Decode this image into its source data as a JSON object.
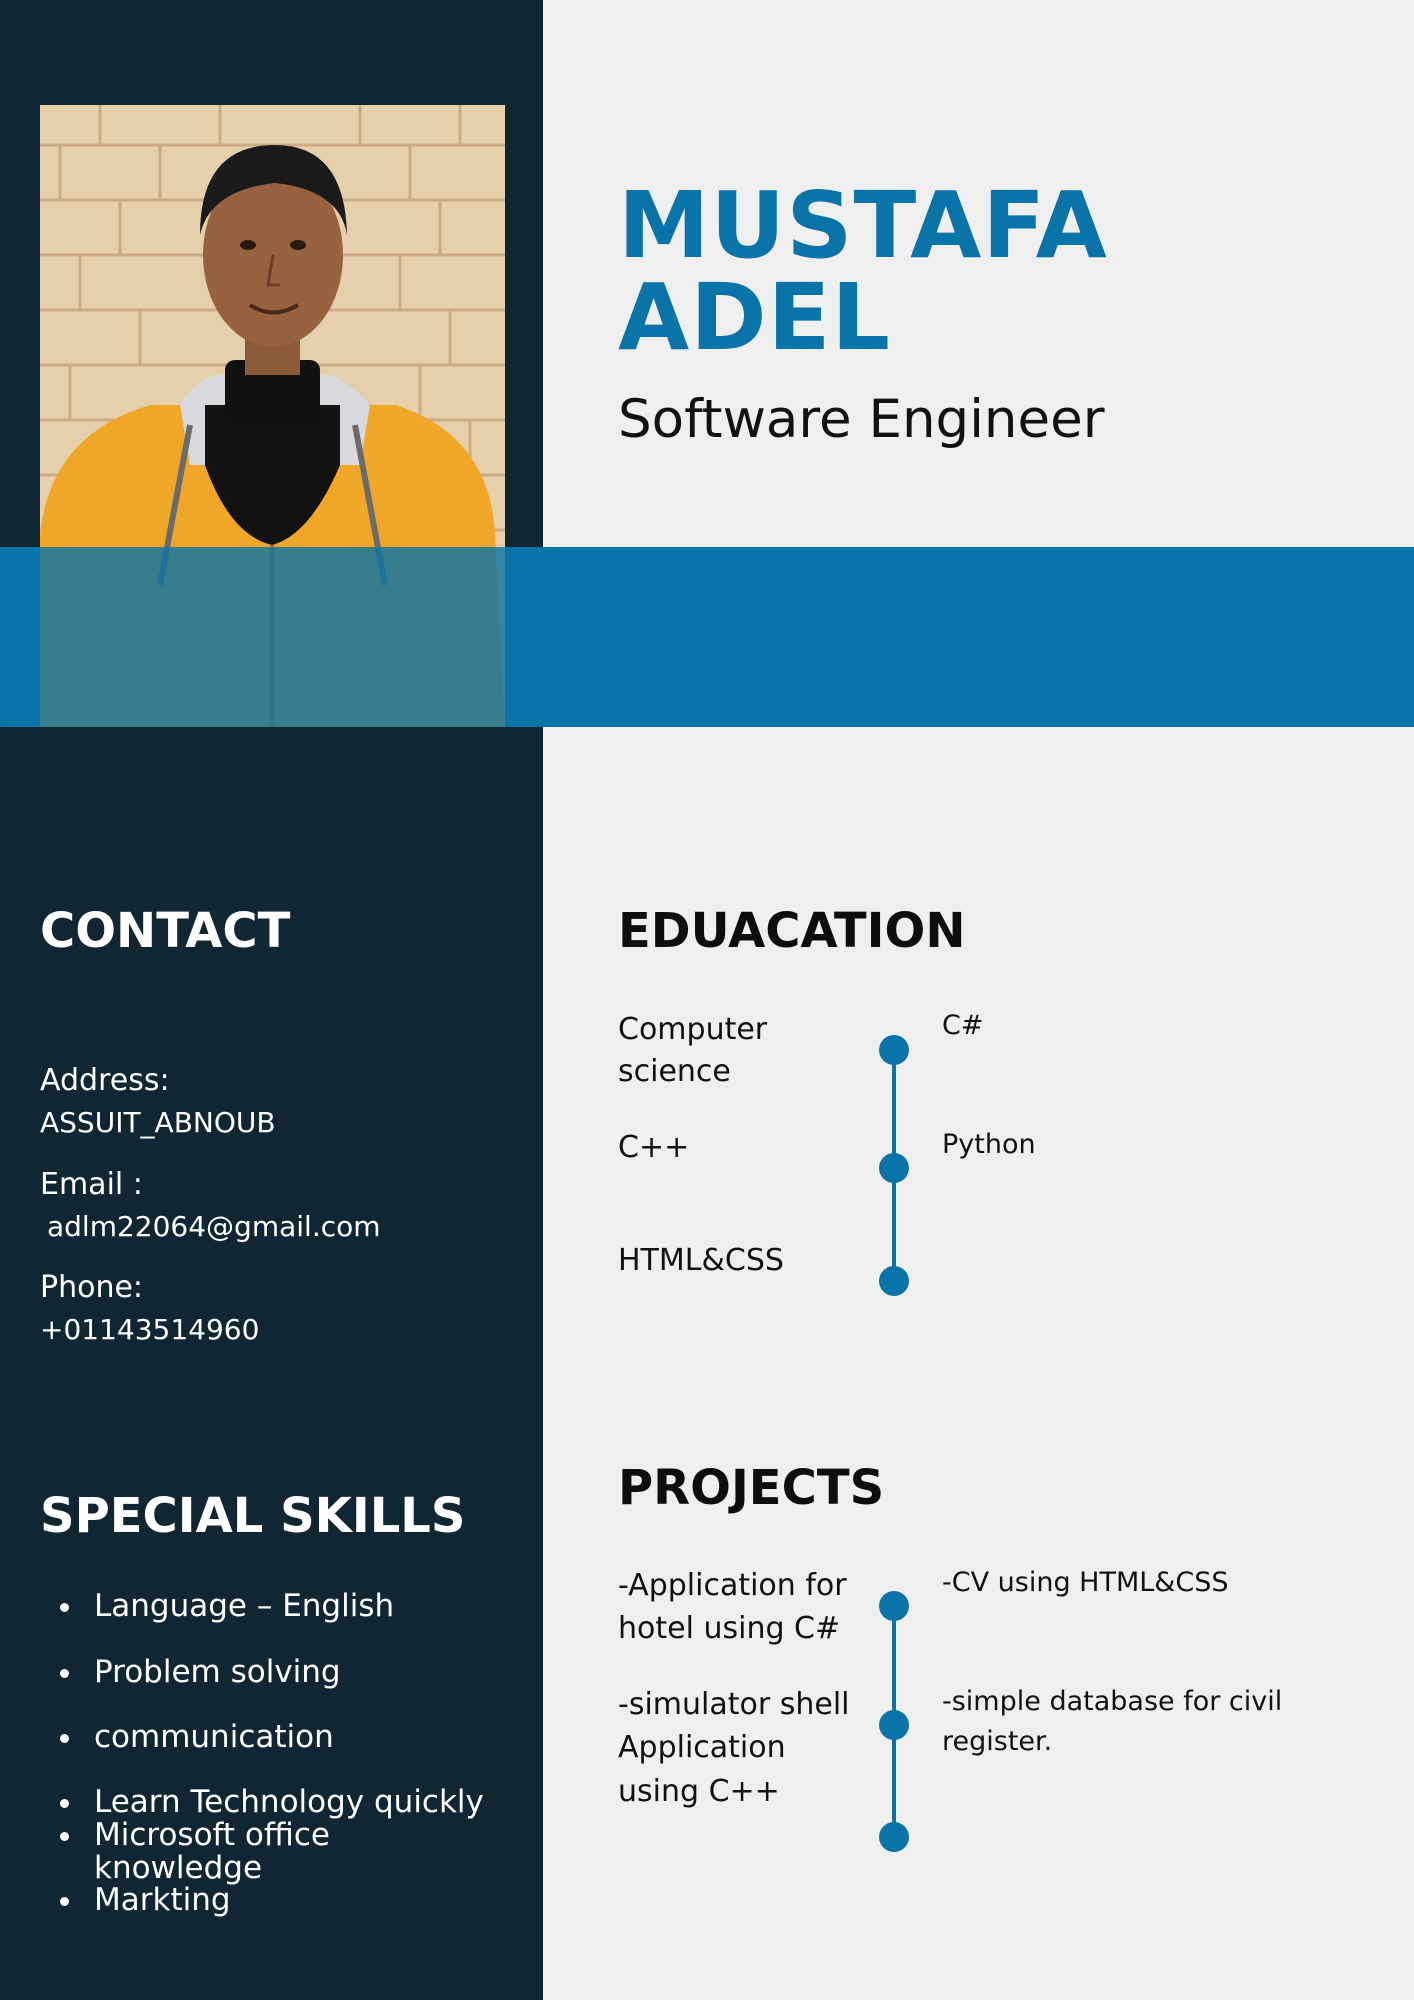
{
  "profile": {
    "first_name": "MUSTAFA",
    "last_name": "ADEL",
    "title": "Software Engineer"
  },
  "contact": {
    "heading": "CONTACT",
    "address_label": "Address:",
    "address_value": "ASSUIT_ABNOUB",
    "email_label": "Email :",
    "email_value": "adlm22064@gmail.com",
    "phone_label": "Phone:",
    "phone_value": "+01143514960"
  },
  "skills": {
    "heading": "SPECIAL SKILLS",
    "items": [
      "Language – English",
      "Problem solving",
      "communication",
      "Learn Technology quickly",
      "Microsoft office",
      "knowledge",
      "Markting"
    ]
  },
  "education": {
    "heading": "EDUACATION",
    "left": [
      "Computer",
      "science",
      "C++",
      "HTML&CSS"
    ],
    "right": [
      "C#",
      "Python"
    ]
  },
  "projects": {
    "heading": "PROJECTS",
    "left": [
      "-Application for",
      "hotel using C#",
      "-simulator shell",
      "Application",
      "using C++"
    ],
    "right": [
      "-CV using HTML&CSS",
      "-simple database for civil",
      "register."
    ]
  },
  "colors": {
    "sidebar": "#112633",
    "accent": "#0a73a8",
    "background": "#efefef"
  }
}
